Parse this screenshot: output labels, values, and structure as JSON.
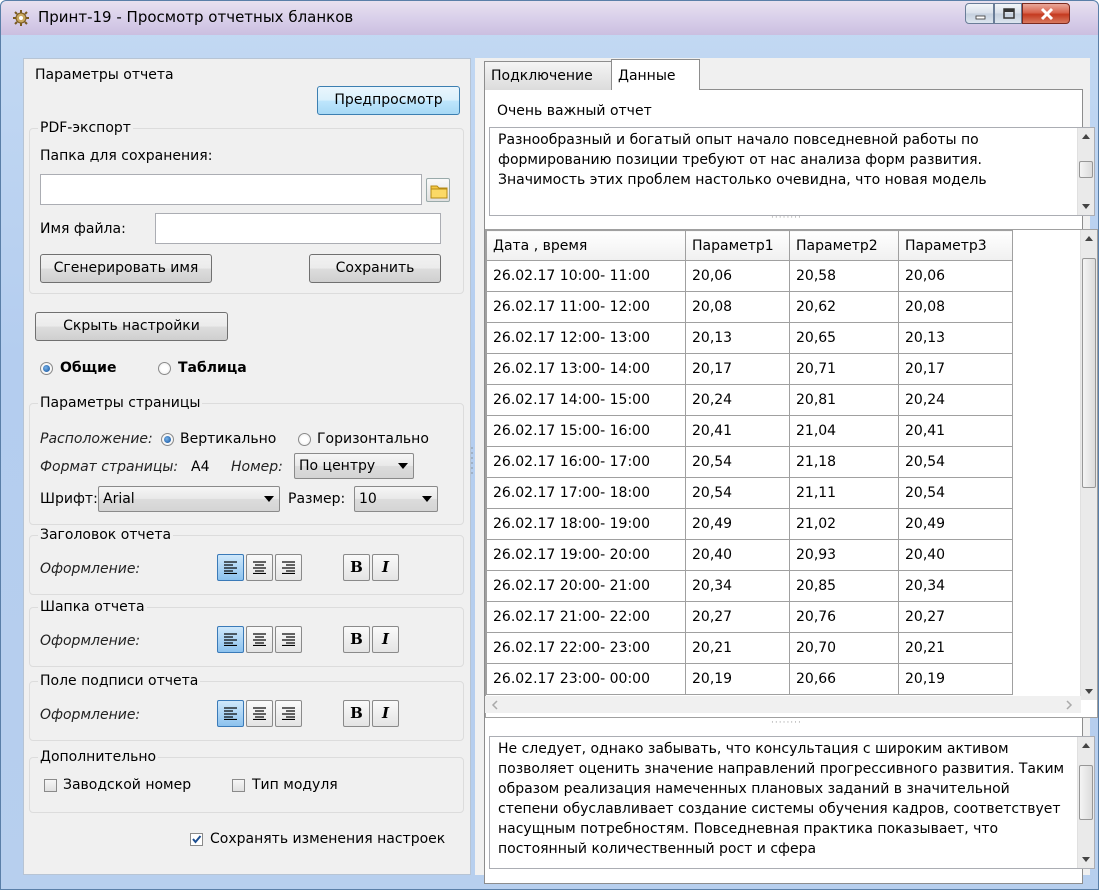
{
  "window": {
    "title": "Принт-19 - Просмотр отчетных бланков",
    "controls": [
      "minimize-icon",
      "maximize-icon",
      "close-icon"
    ]
  },
  "left": {
    "report_params_title": "Параметры отчета",
    "preview_button": "Предпросмотр",
    "pdf": {
      "title": "PDF-экспорт",
      "folder_label": "Папка для сохранения:",
      "folder_value": "",
      "filename_label": "Имя файла:",
      "filename_value": "",
      "generate_button": "Сгенерировать имя",
      "save_button": "Сохранить"
    },
    "hide_settings_button": "Скрыть настройки",
    "mode_general": "Общие",
    "mode_table": "Таблица",
    "page": {
      "title": "Параметры страницы",
      "orientation_label": "Расположение:",
      "orientation_vertical": "Вертикально",
      "orientation_horizontal": "Горизонтально",
      "format_label": "Формат страницы:",
      "format_value": "A4",
      "number_label": "Номер:",
      "number_value": "По центру",
      "font_label": "Шрифт:",
      "font_value": "Arial",
      "size_label": "Размер:",
      "size_value": "10"
    },
    "sections": [
      {
        "title": "Заголовок отчета",
        "style_label": "Оформление:"
      },
      {
        "title": "Шапка отчета",
        "style_label": "Оформление:"
      },
      {
        "title": "Поле подписи отчета",
        "style_label": "Оформление:"
      }
    ],
    "bold_glyph": "B",
    "italic_glyph": "I",
    "extra": {
      "title": "Дополнительно",
      "serial_number": "Заводской номер",
      "module_type": "Тип модуля"
    },
    "save_settings": "Сохранять изменения настроек"
  },
  "right": {
    "tabs": [
      {
        "label": "Подключение"
      },
      {
        "label": "Данные"
      }
    ],
    "report_title": "Очень важный отчет",
    "header_text": "Разнообразный и богатый опыт начало повседневной работы по формированию позиции требуют от нас анализа форм развития. Значимость этих проблем настолько очевидна, что новая модель",
    "grid": {
      "columns": [
        "Дата , время",
        "Параметр1",
        "Параметр2",
        "Параметр3"
      ],
      "rows": [
        [
          "26.02.17   10:00- 11:00",
          "20,06",
          "20,58",
          "20,06"
        ],
        [
          "26.02.17   11:00- 12:00",
          "20,08",
          "20,62",
          "20,08"
        ],
        [
          "26.02.17   12:00- 13:00",
          "20,13",
          "20,65",
          "20,13"
        ],
        [
          "26.02.17   13:00- 14:00",
          "20,17",
          "20,71",
          "20,17"
        ],
        [
          "26.02.17   14:00- 15:00",
          "20,24",
          "20,81",
          "20,24"
        ],
        [
          "26.02.17   15:00- 16:00",
          "20,41",
          "21,04",
          "20,41"
        ],
        [
          "26.02.17   16:00- 17:00",
          "20,54",
          "21,18",
          "20,54"
        ],
        [
          "26.02.17   17:00- 18:00",
          "20,54",
          "21,11",
          "20,54"
        ],
        [
          "26.02.17   18:00- 19:00",
          "20,49",
          "21,02",
          "20,49"
        ],
        [
          "26.02.17   19:00- 20:00",
          "20,40",
          "20,93",
          "20,40"
        ],
        [
          "26.02.17   20:00- 21:00",
          "20,34",
          "20,85",
          "20,34"
        ],
        [
          "26.02.17   21:00- 22:00",
          "20,27",
          "20,76",
          "20,27"
        ],
        [
          "26.02.17   22:00- 23:00",
          "20,21",
          "20,70",
          "20,21"
        ],
        [
          "26.02.17   23:00- 00:00",
          "20,19",
          "20,66",
          "20,19"
        ]
      ]
    },
    "footer_text": "Не следует, однако забывать, что консультация с широким активом позволяет оценить значение направлений прогрессивного развития. Таким образом реализация намеченных плановых заданий в значительной степени обуславливает создание системы обучения кадров, соответствует насущным потребностям. Повседневная практика показывает, что постоянный количественный рост и сфера"
  }
}
